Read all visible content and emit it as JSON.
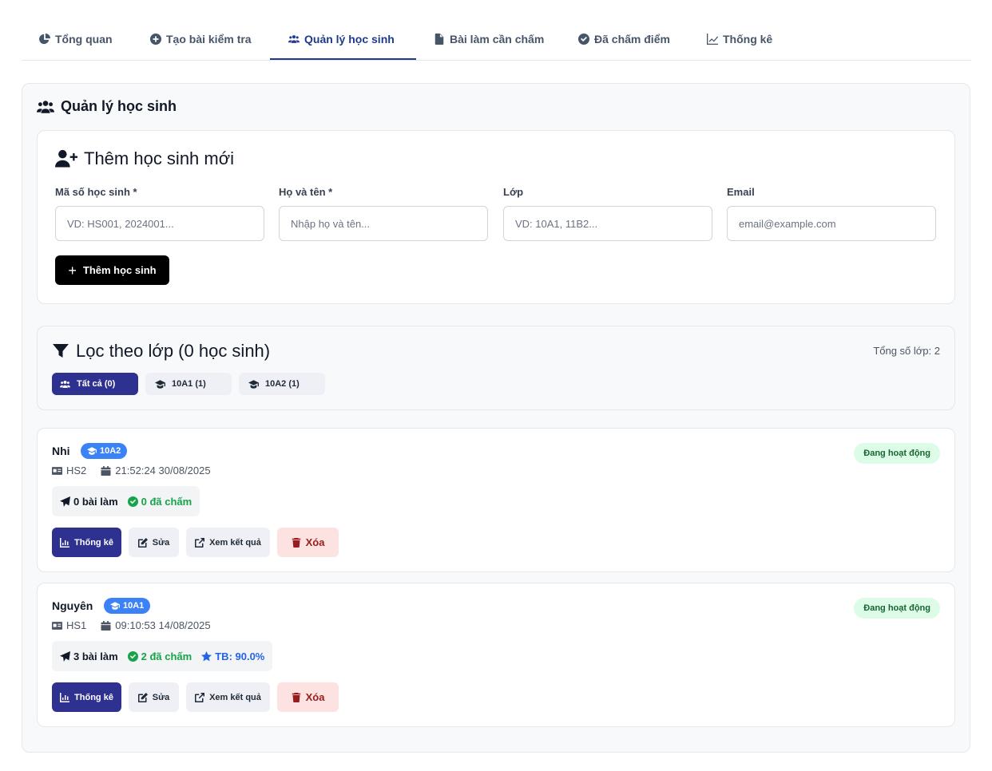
{
  "tabs": [
    {
      "label": "Tổng quan",
      "icon": "pie-chart-icon"
    },
    {
      "label": "Tạo bài kiểm tra",
      "icon": "plus-circle-icon"
    },
    {
      "label": "Quản lý học sinh",
      "icon": "users-icon",
      "active": true
    },
    {
      "label": "Bài làm cần chấm",
      "icon": "file-icon"
    },
    {
      "label": "Đã chấm điểm",
      "icon": "check-circle-icon"
    },
    {
      "label": "Thống kê",
      "icon": "line-chart-icon"
    }
  ],
  "panel": {
    "title": "Quản lý học sinh"
  },
  "add_form": {
    "title": "Thêm học sinh mới",
    "fields": [
      {
        "label": "Mã số học sinh *",
        "placeholder": "VD: HS001, 2024001..."
      },
      {
        "label": "Họ và tên *",
        "placeholder": "Nhập họ và tên..."
      },
      {
        "label": "Lớp",
        "placeholder": "VD: 10A1, 11B2..."
      },
      {
        "label": "Email",
        "placeholder": "email@example.com"
      }
    ],
    "submit_label": "Thêm học sinh"
  },
  "filter": {
    "title": "Lọc theo lớp (0 học sinh)",
    "total_classes": "Tổng số lớp: 2",
    "chips": [
      {
        "label": "Tất cả (0)",
        "active": true
      },
      {
        "label": "10A1 (1)"
      },
      {
        "label": "10A2 (1)"
      }
    ]
  },
  "students": [
    {
      "name": "Nhi",
      "class": "10A2",
      "status": "Đang hoạt động",
      "id": "HS2",
      "created": "21:52:24 30/08/2025",
      "submitted": "0 bài làm",
      "graded": "0 đã chấm",
      "average": null
    },
    {
      "name": "Nguyên",
      "class": "10A1",
      "status": "Đang hoạt động",
      "id": "HS1",
      "created": "09:10:53 14/08/2025",
      "submitted": "3 bài làm",
      "graded": "2 đã chấm",
      "average": "TB: 90.0%"
    }
  ],
  "actions": {
    "stats": "Thống kê",
    "edit": "Sửa",
    "view_results": "Xem kết quả",
    "delete": "Xóa"
  },
  "colors": {
    "primary": "#2e3190",
    "tab_active": "#1e3a8a",
    "badge_blue": "#3b82f6",
    "success": "#16a34a",
    "danger_bg": "#fde2e2",
    "danger_text": "#991b1b"
  }
}
